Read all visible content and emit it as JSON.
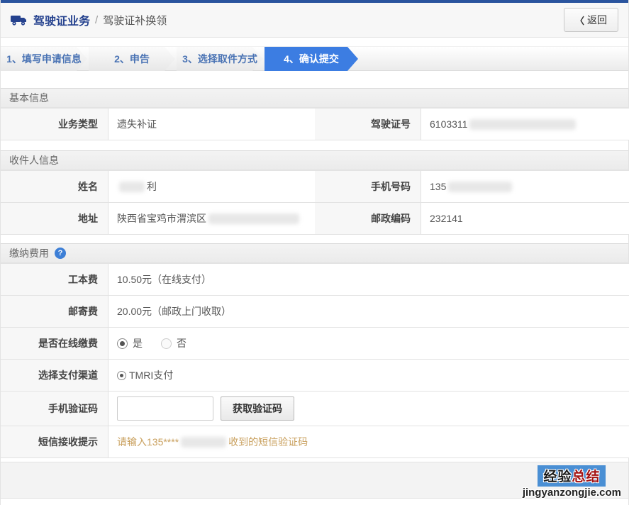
{
  "header": {
    "title": "驾驶证业务",
    "separator": "/",
    "subtitle": "驾驶证补换领",
    "back_icon": "〈",
    "back_label": "返回"
  },
  "steps": [
    {
      "label": "1、填写申请信息",
      "active": false
    },
    {
      "label": "2、申告",
      "active": false
    },
    {
      "label": "3、选择取件方式",
      "active": false
    },
    {
      "label": "4、确认提交",
      "active": true
    }
  ],
  "basic": {
    "title": "基本信息",
    "business_type_label": "业务类型",
    "business_type_value": "遗失补证",
    "license_no_label": "驾驶证号",
    "license_no_value": "6103311"
  },
  "recipient": {
    "title": "收件人信息",
    "name_label": "姓名",
    "name_value_suffix": "利",
    "phone_label": "手机号码",
    "phone_value": "135",
    "address_label": "地址",
    "address_value": "陕西省宝鸡市渭滨区",
    "postcode_label": "邮政编码",
    "postcode_value": "232141"
  },
  "fees": {
    "title": "缴纳费用",
    "help_icon": "?",
    "cost_label": "工本费",
    "cost_value": "10.50元（在线支付）",
    "postage_label": "邮寄费",
    "postage_value": "20.00元（邮政上门收取）",
    "online_label": "是否在线缴费",
    "online_yes": "是",
    "online_no": "否",
    "channel_label": "选择支付渠道",
    "channel_option": "TMRI支付",
    "captcha_label": "手机验证码",
    "captcha_button": "获取验证码",
    "sms_label": "短信接收提示",
    "sms_hint_prefix": "请输入135****",
    "sms_hint_suffix": "收到的短信验证码"
  },
  "watermark": {
    "line1_part1": "经验",
    "line1_part2": "总结",
    "line2": "jingyanzongjie.com"
  },
  "colors": {
    "navy": "#2a549e",
    "accent_blue": "#3c7de2",
    "title_blue": "#24418e",
    "hint_orange": "#c9a05e"
  }
}
